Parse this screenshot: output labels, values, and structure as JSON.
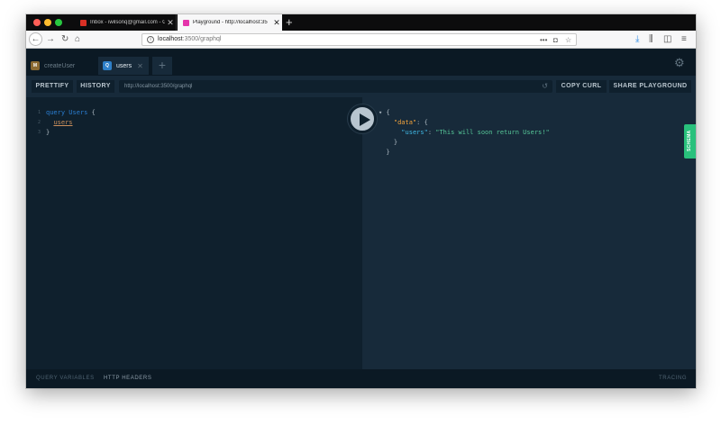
{
  "browser": {
    "tabs": [
      {
        "title": "Inbox - iwilsonq@gmail.com - G",
        "favicon": "gmail-icon"
      },
      {
        "title": "Playground - http://localhost:35",
        "favicon": "playground-icon"
      }
    ],
    "url_host": "localhost",
    "url_path": ":3500/graphql"
  },
  "playground": {
    "tabs": [
      {
        "badge": "M",
        "label": "createUser"
      },
      {
        "badge": "Q",
        "label": "users"
      }
    ],
    "toolbar": {
      "prettify": "PRETTIFY",
      "history": "HISTORY",
      "endpoint": "http://localhost:3500/graphql",
      "copy_curl": "COPY CURL",
      "share": "SHARE PLAYGROUND"
    },
    "editor": {
      "line_numbers": [
        "1",
        "2",
        "3"
      ],
      "keyword": "query",
      "operation": "Users",
      "open_brace": "{",
      "field": "users",
      "close_brace": "}"
    },
    "result": {
      "open": "{",
      "data_key": "\"data\"",
      "users_key": "\"users\"",
      "users_value": "\"This will soon return Users!\""
    },
    "schema_label": "SCHEMA",
    "bottom": {
      "query_variables": "QUERY VARIABLES",
      "http_headers": "HTTP HEADERS",
      "tracing": "TRACING"
    }
  },
  "colors": {
    "background": "#0f202d",
    "panel": "#172a3a",
    "accent_green": "#29c17c",
    "keyword_blue": "#2a7ed3",
    "json_key": "#f2a33c",
    "json_string": "#56c798"
  }
}
